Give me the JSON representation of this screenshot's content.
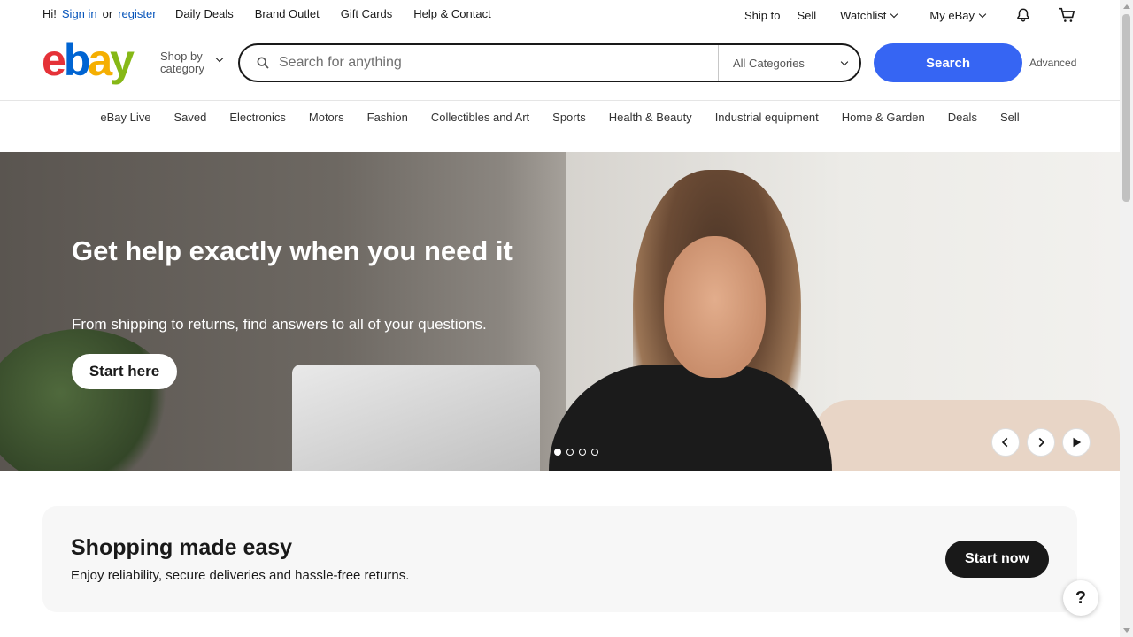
{
  "topbar": {
    "greeting": "Hi!",
    "sign_in": "Sign in",
    "or": "or",
    "register": "register",
    "links": [
      "Daily Deals",
      "Brand Outlet",
      "Gift Cards",
      "Help & Contact"
    ],
    "ship_to": "Ship to",
    "sell": "Sell",
    "watchlist": "Watchlist",
    "my_ebay": "My eBay"
  },
  "header": {
    "logo": {
      "e": "e",
      "b": "b",
      "a": "a",
      "y": "y"
    },
    "shop_by_1": "Shop by",
    "shop_by_2": "category",
    "search_placeholder": "Search for anything",
    "category_select": "All Categories",
    "search_button": "Search",
    "advanced": "Advanced"
  },
  "nav": {
    "items": [
      "eBay Live",
      "Saved",
      "Electronics",
      "Motors",
      "Fashion",
      "Collectibles and Art",
      "Sports",
      "Health & Beauty",
      "Industrial equipment",
      "Home & Garden",
      "Deals",
      "Sell"
    ]
  },
  "hero": {
    "title": "Get help exactly when you need it",
    "subtitle": "From shipping to returns, find answers to all of your questions.",
    "button": "Start here",
    "slide_count": 4,
    "active_slide": 1
  },
  "promo": {
    "title": "Shopping made easy",
    "subtitle": "Enjoy reliability, secure deliveries and hassle-free returns.",
    "button": "Start now"
  },
  "help_button": "?",
  "colors": {
    "accent": "#3665f3",
    "link": "#0654ba",
    "logo_e": "#e53238",
    "logo_b": "#0064d2",
    "logo_a": "#f5af02",
    "logo_y": "#86b817"
  }
}
